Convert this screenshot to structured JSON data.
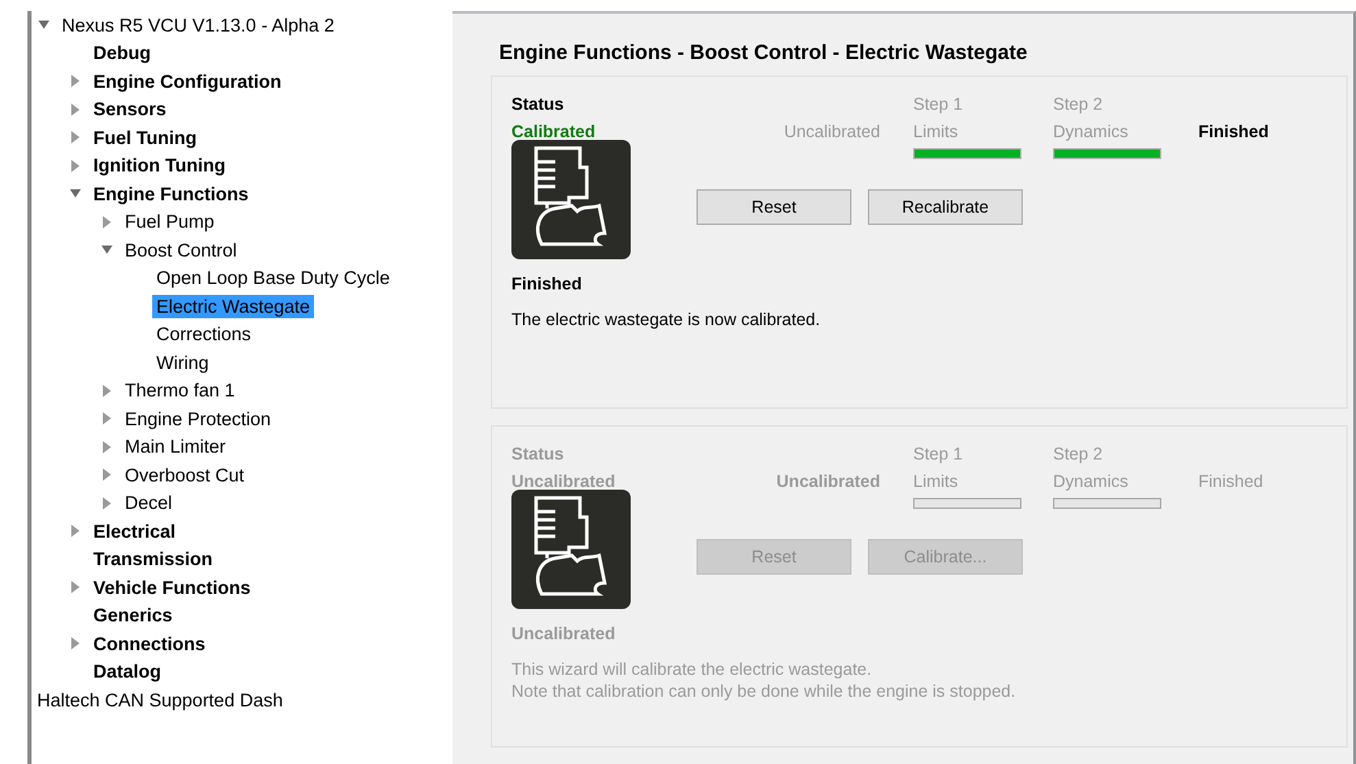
{
  "tree": [
    {
      "label": "Nexus R5 VCU V1.13.0 - Alpha 2",
      "kind": "group",
      "expanded": true,
      "selected": false,
      "children": [
        {
          "label": "Debug",
          "kind": "leaf",
          "selected": false
        },
        {
          "label": "Engine Configuration",
          "kind": "group",
          "expanded": false,
          "selected": false
        },
        {
          "label": "Sensors",
          "kind": "group",
          "expanded": false,
          "selected": false
        },
        {
          "label": "Fuel Tuning",
          "kind": "group",
          "expanded": false,
          "selected": false
        },
        {
          "label": "Ignition Tuning",
          "kind": "group",
          "expanded": false,
          "selected": false
        },
        {
          "label": "Engine Functions",
          "kind": "group",
          "expanded": true,
          "selected": false,
          "children": [
            {
              "label": "Fuel Pump",
              "kind": "group",
              "expanded": false,
              "selected": false
            },
            {
              "label": "Boost Control",
              "kind": "group",
              "expanded": true,
              "selected": false,
              "children": [
                {
                  "label": "Open Loop Base Duty Cycle",
                  "kind": "leaf",
                  "selected": false
                },
                {
                  "label": "Electric Wastegate",
                  "kind": "leaf",
                  "selected": true
                },
                {
                  "label": "Corrections",
                  "kind": "leaf",
                  "selected": false
                },
                {
                  "label": "Wiring",
                  "kind": "leaf",
                  "selected": false
                }
              ]
            },
            {
              "label": "Thermo fan 1",
              "kind": "group",
              "expanded": false,
              "selected": false
            },
            {
              "label": "Engine Protection",
              "kind": "group",
              "expanded": false,
              "selected": false
            },
            {
              "label": "Main Limiter",
              "kind": "group",
              "expanded": false,
              "selected": false
            },
            {
              "label": "Overboost Cut",
              "kind": "group",
              "expanded": false,
              "selected": false
            },
            {
              "label": "Decel",
              "kind": "group",
              "expanded": false,
              "selected": false
            }
          ]
        },
        {
          "label": "Electrical",
          "kind": "group",
          "expanded": false,
          "selected": false
        },
        {
          "label": "Transmission",
          "kind": "leaf",
          "selected": false
        },
        {
          "label": "Vehicle Functions",
          "kind": "group",
          "expanded": false,
          "selected": false
        },
        {
          "label": "Generics",
          "kind": "leaf",
          "selected": false
        },
        {
          "label": "Connections",
          "kind": "group",
          "expanded": false,
          "selected": false
        },
        {
          "label": "Datalog",
          "kind": "leaf",
          "selected": false
        }
      ]
    },
    {
      "label": "Haltech CAN Supported Dash",
      "kind": "leaf",
      "selected": false
    }
  ],
  "page": {
    "title": "Engine Functions - Boost Control - Electric Wastegate",
    "wizards": [
      {
        "disabled": false,
        "status_label": "Status",
        "status": "Calibrated",
        "calibrated": true,
        "stages": [
          {
            "kind": "state",
            "label": "Uncalibrated",
            "current": false
          },
          {
            "kind": "step",
            "step": "Step 1",
            "label": "Limits",
            "level": 1,
            "current": false
          },
          {
            "kind": "step",
            "step": "Step 2",
            "label": "Dynamics",
            "level": 1,
            "current": false
          },
          {
            "kind": "state",
            "label": "Finished",
            "current": true
          }
        ],
        "buttons": [
          {
            "label": "Reset",
            "disabled": false
          },
          {
            "label": "Recalibrate",
            "disabled": false
          }
        ],
        "caption": "Finished",
        "message_lines": [
          "The electric wastegate is now calibrated."
        ]
      },
      {
        "disabled": true,
        "status_label": "Status",
        "status": "Uncalibrated",
        "calibrated": false,
        "stages": [
          {
            "kind": "state",
            "label": "Uncalibrated",
            "current": true
          },
          {
            "kind": "step",
            "step": "Step 1",
            "label": "Limits",
            "level": 0,
            "current": false
          },
          {
            "kind": "step",
            "step": "Step 2",
            "label": "Dynamics",
            "level": 0,
            "current": false
          },
          {
            "kind": "state",
            "label": "Finished",
            "current": false
          }
        ],
        "buttons": [
          {
            "label": "Reset",
            "disabled": true
          },
          {
            "label": "Calibrate...",
            "disabled": true
          }
        ],
        "caption": "Uncalibrated",
        "message_lines": [
          "This wizard will calibrate the electric wastegate.",
          "Note that calibration can only be done while the engine is stopped."
        ]
      }
    ]
  }
}
